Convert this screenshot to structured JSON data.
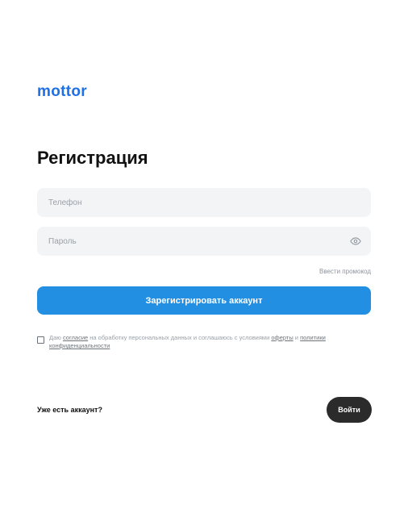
{
  "brand": {
    "logo_text": "mottor",
    "accent_color": "#1f6fe5"
  },
  "form": {
    "title": "Регистрация",
    "phone_placeholder": "Телефон",
    "phone_value": "",
    "password_placeholder": "Пароль",
    "password_value": "",
    "password_toggle_icon": "eye-icon",
    "promo_link": "Ввести промокод",
    "submit_label": "Зарегистрировать аккаунт",
    "submit_color": "#228fe3"
  },
  "consent": {
    "checked": false,
    "text_1": "Даю ",
    "link_agreement": "согласие",
    "text_2": " на обработку персональных данных и соглашаюсь с условиями ",
    "link_offer": "оферты",
    "text_3": " и ",
    "link_policy": "политики конфиденциальности"
  },
  "footer": {
    "have_account_text": "Уже есть аккаунт?",
    "login_label": "Войти"
  }
}
